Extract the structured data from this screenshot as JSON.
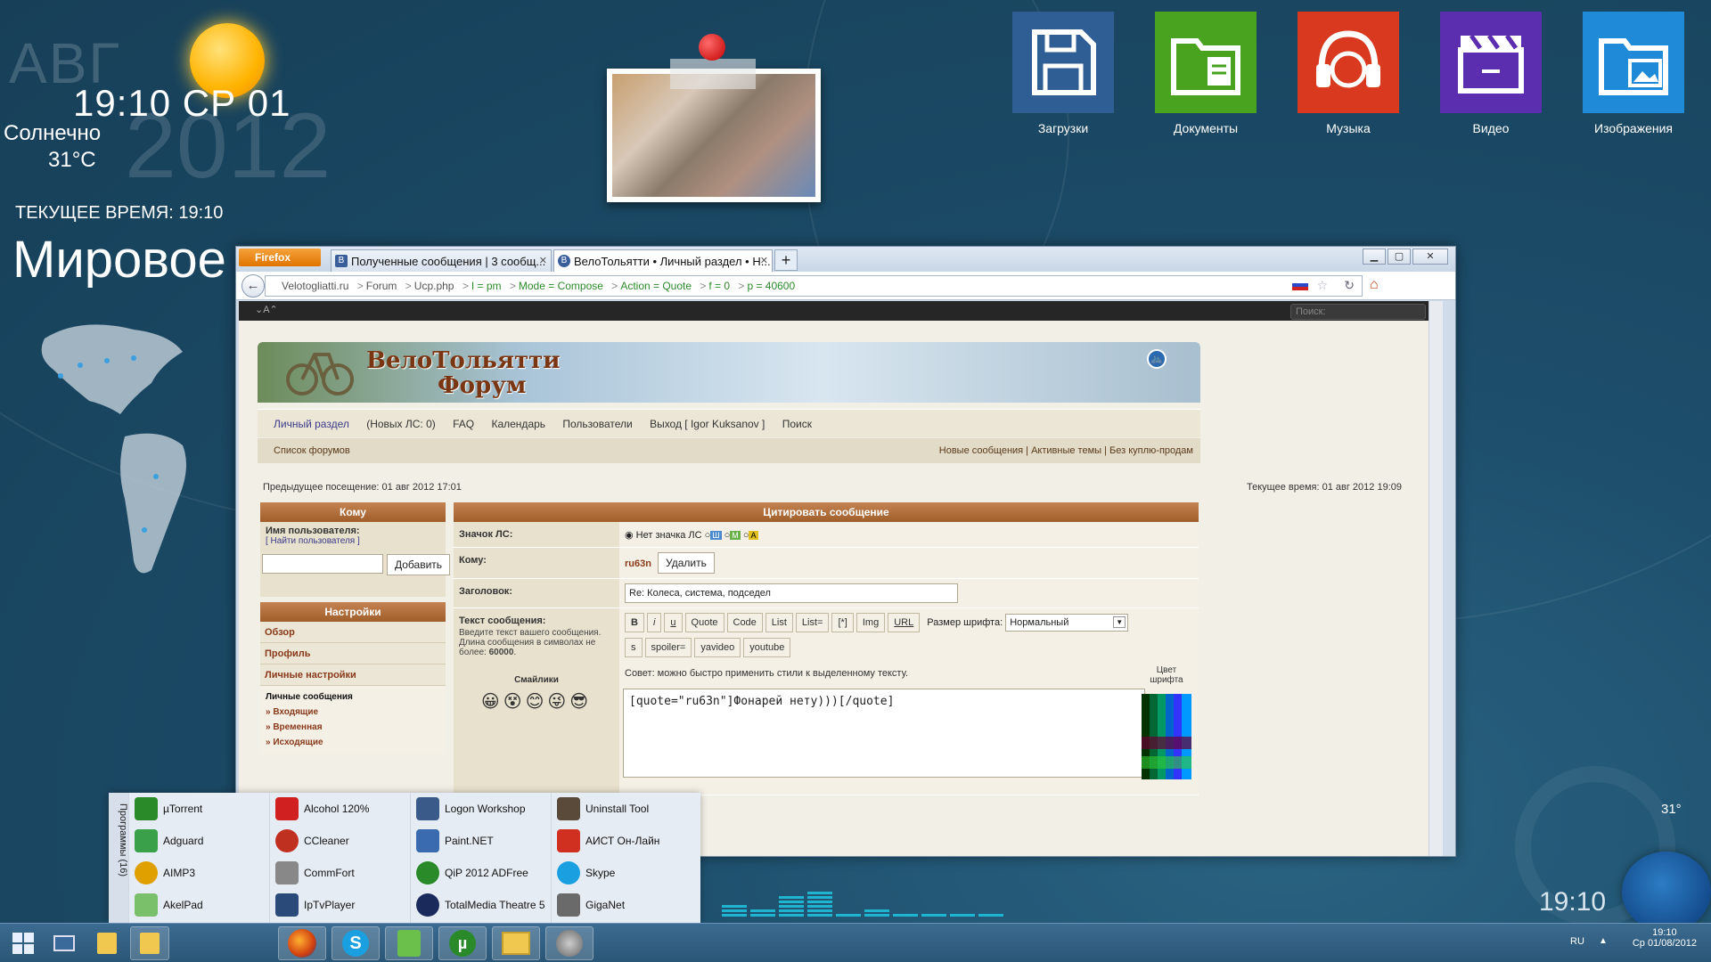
{
  "desktop": {
    "weather": {
      "month": "АВГ",
      "year": "2012",
      "time_day": "19:10 СР 01",
      "condition": "Солнечно",
      "temperature": "31°C"
    },
    "world_clock": {
      "label": "ТЕКУЩЕЕ ВРЕМЯ: 19:10",
      "title": "Мировое"
    },
    "tiles": [
      {
        "label": "Загрузки",
        "icon": "floppy-icon",
        "color": "#2f5e94"
      },
      {
        "label": "Документы",
        "icon": "folder-document-icon",
        "color": "#4aa31f"
      },
      {
        "label": "Музыка",
        "icon": "headphones-icon",
        "color": "#d9391f"
      },
      {
        "label": "Видео",
        "icon": "clapperboard-icon",
        "color": "#5b2eb0"
      },
      {
        "label": "Изображения",
        "icon": "folder-image-icon",
        "color": "#1e8ad8"
      }
    ],
    "clock_big": "19:10",
    "tray_temp": "31°"
  },
  "browser": {
    "menu_button": "Firefox",
    "tabs": [
      {
        "title": "Полученные сообщения | 3 сообщ...",
        "icon": "vk-icon",
        "active": false
      },
      {
        "title": "ВелоТольятти • Личный раздел • Н...",
        "icon": "site-icon",
        "active": true
      }
    ],
    "new_tab": "+",
    "url_parts": [
      "Velotogliatti.ru",
      "Forum",
      "Ucp.php",
      "I = pm",
      "Mode = Compose",
      "Action = Quote",
      "f = 0",
      "p = 40600"
    ]
  },
  "forum": {
    "search_placeholder": "Поиск:",
    "banner": {
      "title": "ВелоТольятти",
      "subtitle": "Форум"
    },
    "menu": [
      "Личный раздел",
      "(Новых ЛС: 0)",
      "FAQ",
      "Календарь",
      "Пользователи",
      "Выход [ Igor Kuksanov ]",
      "Поиск"
    ],
    "forum_list": "Список форумов",
    "quick_links": "Новые сообщения | Активные темы | Без куплю-продам",
    "last_visit": "Предыдущее посещение: 01 авг 2012 17:01",
    "current_time": "Текущее время: 01 авг 2012 19:09",
    "to_panel": {
      "header": "Кому",
      "username_label": "Имя пользователя:",
      "find_link": "[ Найти пользователя ]",
      "add_button": "Добавить"
    },
    "settings_panel": {
      "header": "Настройки",
      "items": [
        "Обзор",
        "Профиль",
        "Личные настройки"
      ],
      "pm_title": "Личные сообщения",
      "pm_items": [
        "» Входящие",
        "» Временная",
        "» Исходящие"
      ]
    },
    "compose": {
      "header": "Цитировать сообщение",
      "icon_label": "Значок ЛС:",
      "no_icon": "Нет значка ЛС",
      "to_label": "Кому:",
      "recipient": "ru63n",
      "remove_button": "Удалить",
      "subject_label": "Заголовок:",
      "subject_value": "Re: Колеса, система, подседел",
      "body_label": "Текст сообщения:",
      "body_hint": "Введите текст вашего сообщения. Длина сообщения в символах не более:",
      "body_limit": "60000",
      "smilies_label": "Смайлики",
      "format_buttons": [
        "B",
        "i",
        "u",
        "Quote",
        "Code",
        "List",
        "List=",
        "[*]",
        "Img",
        "URL"
      ],
      "format_buttons2": [
        "s",
        "spoiler=",
        "yavideo",
        "youtube"
      ],
      "font_size_label": "Размер шрифта:",
      "font_size_value": "Нормальный",
      "tip": "Совет: можно быстро применить стили к выделенному тексту.",
      "color_label": "Цвет шрифта",
      "message": "[quote=\"ru63n\"]Фонарей нету)))[/quote]"
    }
  },
  "start_menu": {
    "title": "Программы (16)",
    "columns": [
      [
        {
          "name": "µTorrent",
          "color": "#2a8a2a"
        },
        {
          "name": "Adguard",
          "color": "#3aa04a"
        },
        {
          "name": "AIMP3",
          "color": "#e0a000"
        },
        {
          "name": "AkelPad",
          "color": "#7ac06a"
        }
      ],
      [
        {
          "name": "Alcohol 120%",
          "color": "#d02020"
        },
        {
          "name": "CCleaner",
          "color": "#c03020"
        },
        {
          "name": "CommFort",
          "color": "#888888"
        },
        {
          "name": "IpTvPlayer",
          "color": "#2a4a7a"
        }
      ],
      [
        {
          "name": "Logon Workshop",
          "color": "#3a5a8a"
        },
        {
          "name": "Paint.NET",
          "color": "#3a6ab0"
        },
        {
          "name": "QiP 2012 ADFree",
          "color": "#2a8a2a"
        },
        {
          "name": "TotalMedia Theatre 5",
          "color": "#1a2a5a"
        }
      ],
      [
        {
          "name": "Uninstall Tool",
          "color": "#5a4a3a"
        },
        {
          "name": "АИСТ Он-Лайн",
          "color": "#d03020"
        },
        {
          "name": "Skype",
          "color": "#1aa0e0"
        },
        {
          "name": "GigaNet",
          "color": "#6a6a6a"
        }
      ]
    ]
  },
  "taskbar": {
    "lang": "RU",
    "time": "19:10",
    "date": "Ср 01/08/2012"
  }
}
